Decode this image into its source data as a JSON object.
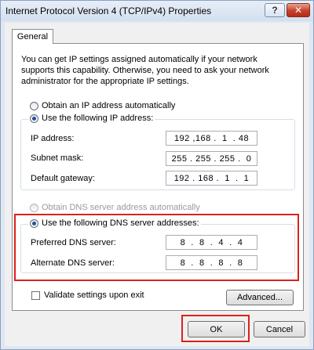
{
  "window": {
    "title": "Internet Protocol Version 4 (TCP/IPv4) Properties",
    "help_label": "?",
    "close_label": "✕"
  },
  "tabs": [
    {
      "label": "General",
      "selected": true
    }
  ],
  "description": "You can get IP settings assigned automatically if your network supports this capability. Otherwise, you need to ask your network administrator for the appropriate IP settings.",
  "ip": {
    "auto_label": "Obtain an IP address automatically",
    "auto_selected": false,
    "manual_label": "Use the following IP address:",
    "manual_selected": true,
    "fields": [
      {
        "label": "IP address:",
        "value": "192 ,168 .  1  . 48"
      },
      {
        "label": "Subnet mask:",
        "value": "255 . 255 . 255 .  0"
      },
      {
        "label": "Default gateway:",
        "value": "192 . 168 .  1  .  1"
      }
    ]
  },
  "dns": {
    "auto_label": "Obtain DNS server address automatically",
    "auto_selected": false,
    "auto_disabled": true,
    "manual_label": "Use the following DNS server addresses:",
    "manual_selected": true,
    "fields": [
      {
        "label": "Preferred DNS server:",
        "value": "8  .  8  .  4  .  4"
      },
      {
        "label": "Alternate DNS server:",
        "value": "8  .  8  .  8  .  8"
      }
    ]
  },
  "validate": {
    "label": "Validate settings upon exit",
    "checked": false
  },
  "buttons": {
    "advanced": "Advanced...",
    "ok": "OK",
    "cancel": "Cancel"
  },
  "colors": {
    "highlight": "#d9231c",
    "selected_radio": "#1f4f9c"
  }
}
